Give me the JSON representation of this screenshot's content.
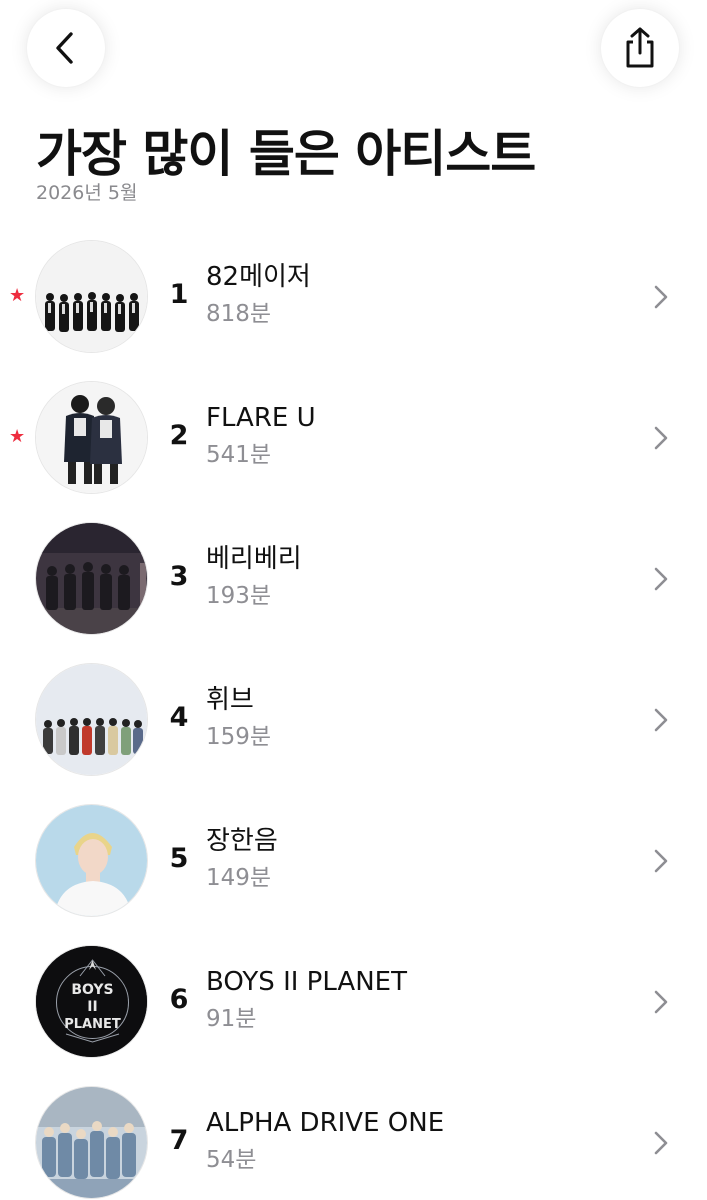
{
  "header": {
    "title": "가장 많이 들은 아티스트",
    "subtitle": "2026년 5월",
    "back_icon": "chevron-left-icon",
    "share_icon": "share-icon"
  },
  "colors": {
    "star": "#ee2d3f",
    "secondary_text": "#8e8e93"
  },
  "artists": [
    {
      "rank": "1",
      "name": "82메이저",
      "minutes": "818분",
      "starred": true
    },
    {
      "rank": "2",
      "name": "FLARE U",
      "minutes": "541분",
      "starred": true
    },
    {
      "rank": "3",
      "name": "베리베리",
      "minutes": "193분",
      "starred": false
    },
    {
      "rank": "4",
      "name": "휘브",
      "minutes": "159분",
      "starred": false
    },
    {
      "rank": "5",
      "name": "장한음",
      "minutes": "149분",
      "starred": false
    },
    {
      "rank": "6",
      "name": "BOYS II PLANET",
      "minutes": "91분",
      "starred": false,
      "logo_text": [
        "BOYS",
        "II",
        "PLANET"
      ]
    },
    {
      "rank": "7",
      "name": "ALPHA DRIVE ONE",
      "minutes": "54분",
      "starred": false
    }
  ]
}
